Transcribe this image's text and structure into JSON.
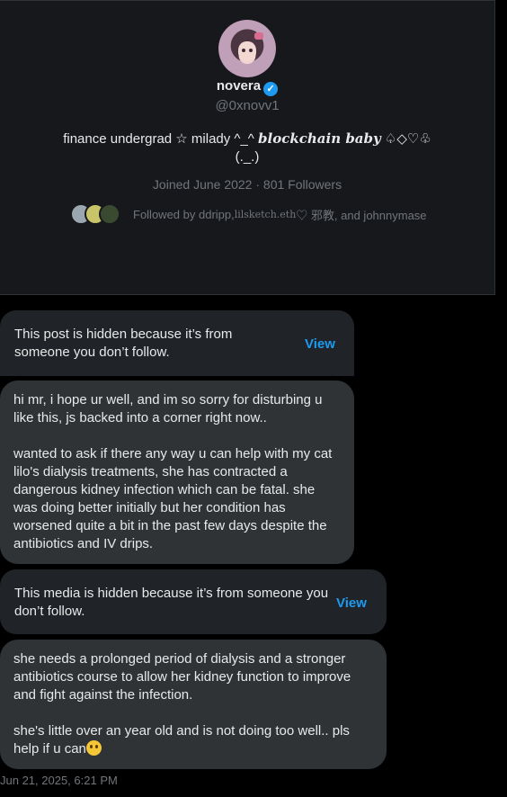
{
  "profile": {
    "name": "novera",
    "verified_glyph": "✓",
    "handle": "@0xnovv1",
    "bio_line1_pre": "finance undergrad ☆ milady ^_^ ",
    "bio_line1_emph": "blockchain baby",
    "bio_line1_post": " ♤◇♡♧",
    "bio_line2": "(._.)",
    "joined": "Joined June 2022",
    "separator": "·",
    "followers": "801 Followers",
    "followed_by_pre": "Followed by ddripp, ",
    "followed_by_serif": "lilsketch.eth",
    "followed_by_post": " ♡ 邪教, and johnnymase"
  },
  "messages": {
    "hidden_post_text": "This post is hidden because it’s from someone you don’t follow.",
    "hidden_post_view": "View",
    "msg1": "hi mr, i hope ur well, and im so sorry for disturbing u like this, js backed into a corner right now..\n\nwanted to ask if there any way u can help with my cat lilo's dialysis treatments, she has contracted a dangerous kidney infection which can be fatal. she was doing better initially but her condition has worsened quite a bit in the past few days despite the antibiotics and IV drips.",
    "hidden_media_text": "This media is hidden because it’s from someone you don’t follow.",
    "hidden_media_view": "View",
    "msg2_para1": "she needs a prolonged period of dialysis and a stronger antibiotics course to allow her kidney function to improve and fight against the infection.",
    "msg2_para2": "she's little over an year old and is not doing too well.. pls help if u can",
    "timestamp": "Jun 21, 2025, 6:21 PM"
  },
  "colors": {
    "accent": "#1d9bf0",
    "bubble": "#2f3336",
    "card": "#16181c"
  }
}
